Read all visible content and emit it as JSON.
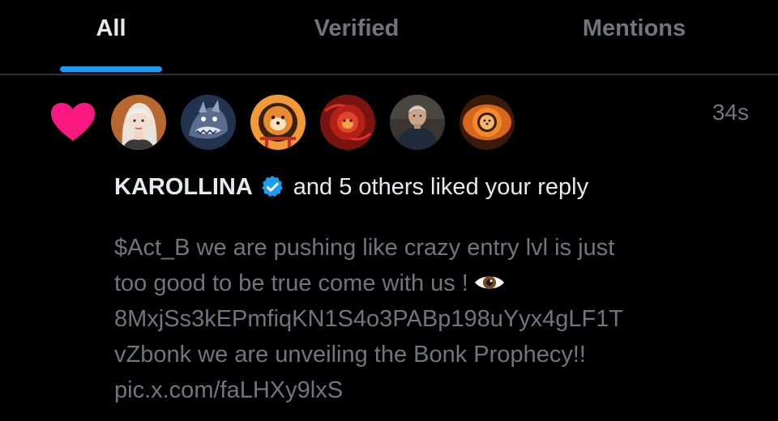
{
  "tabs": [
    {
      "label": "All",
      "active": true
    },
    {
      "label": "Verified",
      "active": false
    },
    {
      "label": "Mentions",
      "active": false
    }
  ],
  "colors": {
    "background": "#000000",
    "accent": "#1d9bf0",
    "heart": "#f91880",
    "primary_text": "#e7e9ea",
    "secondary_text": "#71767b",
    "divider": "#2f3336"
  },
  "notification": {
    "icon": "heart-icon",
    "timestamp": "34s",
    "avatars": [
      {
        "name": "avatar-karollina"
      },
      {
        "name": "avatar-2"
      },
      {
        "name": "avatar-3"
      },
      {
        "name": "avatar-4"
      },
      {
        "name": "avatar-5"
      },
      {
        "name": "avatar-6"
      }
    ],
    "actor_name": "KAROLLINA",
    "actor_verified": true,
    "action_text": "and 5 others liked your reply",
    "reply_lines": [
      "$Act_B we are pushing like crazy entry lvl is just",
      "too good to be true come with us !",
      "8MxjSs3kEPmfiqKN1S4o3PABp198uYyx4gLF1T",
      "vZbonk we are unveiling the Bonk Prophecy!!",
      "pic.x.com/faLHXy9lxS"
    ],
    "emoji_icon": "eye-emoji-icon"
  }
}
